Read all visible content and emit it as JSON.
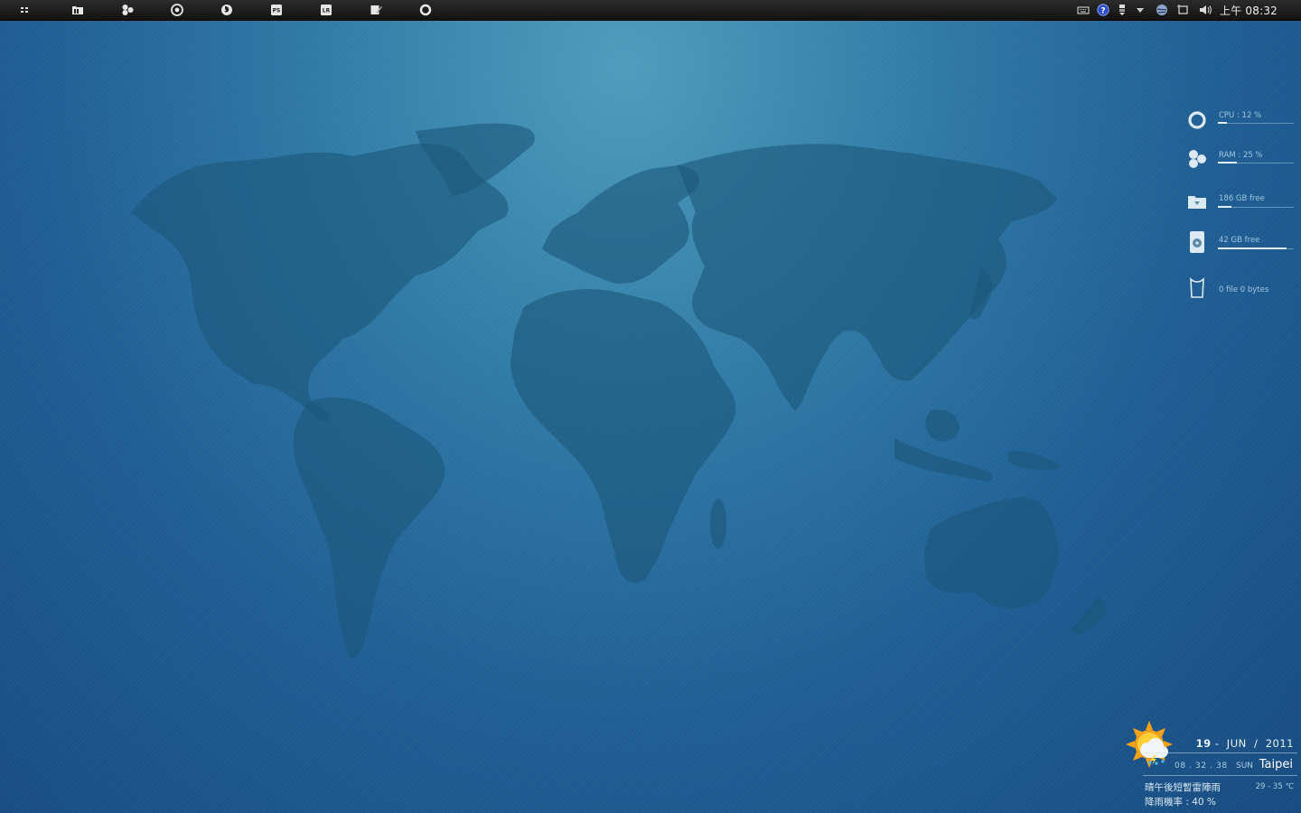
{
  "taskbar": {
    "launchers": [
      {
        "icon": "apps-grid-icon"
      },
      {
        "icon": "file-manager-icon"
      },
      {
        "icon": "system-monitor-icon"
      },
      {
        "icon": "chrome-icon"
      },
      {
        "icon": "firefox-icon"
      },
      {
        "icon": "photoshop-icon",
        "label": "PS"
      },
      {
        "icon": "lightroom-icon",
        "label": "LR"
      },
      {
        "icon": "notepad-icon"
      },
      {
        "icon": "circle-dock-icon"
      }
    ],
    "tray": [
      "keyboard-icon",
      "help-icon",
      "network-adapter-icon",
      "tray-expand-icon",
      "globe-icon",
      "display-icon",
      "volume-icon"
    ],
    "clock": "上午 08:32"
  },
  "meter": {
    "cpu": {
      "label": "CPU : 12 %",
      "value": 0.12
    },
    "ram": {
      "label": "RAM : 25 %",
      "value": 0.25
    },
    "disk1": {
      "label": "186 GB free",
      "value": 0.18
    },
    "disk2": {
      "label": "42 GB free",
      "value": 0.9
    },
    "recycle": {
      "label": "0  file   0 bytes"
    }
  },
  "weather": {
    "day": "19",
    "sep1": "-",
    "month": "JUN",
    "sep2": "/",
    "year": "2011",
    "time": "08 . 32 . 38",
    "weekday": "SUN",
    "city": "Taipei",
    "condition": "晴午後短暫雷陣雨",
    "temperature": "29 - 35 ℃",
    "rain_chance": "降雨機率 : 40 %",
    "icon": "sun-cloud-rain-icon"
  },
  "colors": {
    "accent": "#2f7aa6",
    "taskbar": "#1b1b1b"
  }
}
